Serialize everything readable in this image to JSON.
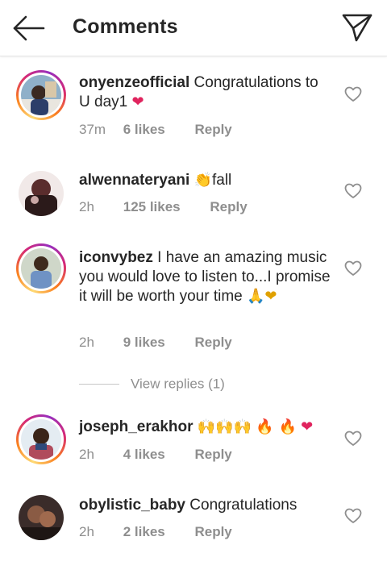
{
  "header": {
    "title": "Comments"
  },
  "comments": [
    {
      "username": "onyenzeofficial",
      "text": " Congratulations to U day1",
      "emoji": "❤",
      "time": "37m",
      "likes": "6 likes",
      "reply": "Reply"
    },
    {
      "username": "alwennateryani",
      "emoji": "👏",
      "text": "fall",
      "time": "2h",
      "likes": "125 likes",
      "reply": "Reply"
    },
    {
      "username": "iconvybez",
      "text": " I have an amazing music you would love to listen to...I promise it will be worth your time ",
      "emoji": "🙏❤",
      "time": "2h",
      "likes": "9 likes",
      "reply": "Reply",
      "view_replies": "View replies (1)"
    },
    {
      "username": "joseph_erakhor",
      "emoji_hands": "🙌🙌🙌",
      "emoji_fire": "🔥 🔥",
      "emoji_heart": "❤",
      "time": "2h",
      "likes": "4 likes",
      "reply": "Reply"
    },
    {
      "username": "obylistic_baby",
      "text": " Congratulations",
      "time": "2h",
      "likes": "2 likes",
      "reply": "Reply"
    }
  ],
  "icons": {
    "back": "arrow-left-icon",
    "share": "paper-plane-icon",
    "like": "heart-outline-icon"
  },
  "colors": {
    "text": "#262626",
    "secondary": "#8e8e8e",
    "heart_emoji": "#e0245e"
  }
}
